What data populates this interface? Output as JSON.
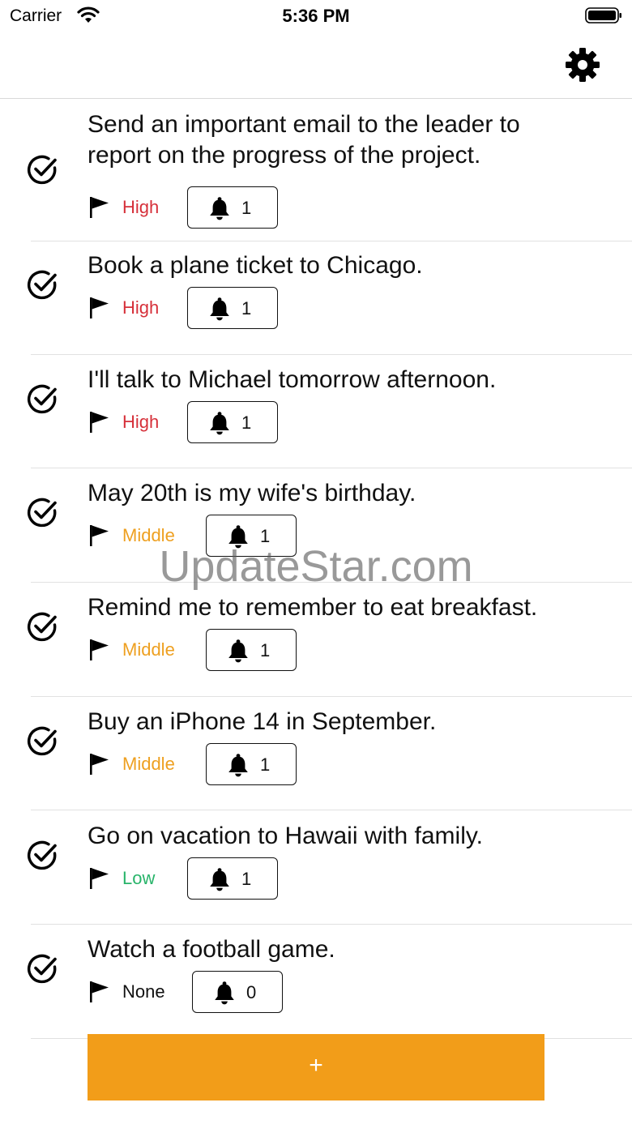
{
  "status_bar": {
    "carrier": "Carrier",
    "time": "5:36 PM"
  },
  "header": {
    "settings_icon": "gear-icon"
  },
  "tasks": [
    {
      "title": "Send an important email to the leader to report on the progress of the project.",
      "priority": "High",
      "reminders": "1"
    },
    {
      "title": "Book a plane ticket to Chicago.",
      "priority": "High",
      "reminders": "1"
    },
    {
      "title": "I'll talk to Michael tomorrow afternoon.",
      "priority": "High",
      "reminders": "1"
    },
    {
      "title": "May 20th is my wife's birthday.",
      "priority": "Middle",
      "reminders": "1"
    },
    {
      "title": "Remind me to remember to eat breakfast.",
      "priority": "Middle",
      "reminders": "1"
    },
    {
      "title": "Buy an iPhone 14 in September.",
      "priority": "Middle",
      "reminders": "1"
    },
    {
      "title": "Go on vacation to Hawaii with family.",
      "priority": "Low",
      "reminders": "1"
    },
    {
      "title": "Watch a football game.",
      "priority": "None",
      "reminders": "0"
    }
  ],
  "priority_colors": {
    "High": "#d6303a",
    "Middle": "#eea021",
    "Low": "#28b46a",
    "None": "#111111"
  },
  "add_button": {
    "label": "+",
    "color": "#f29d19"
  },
  "watermark": "UpdateStar.com"
}
